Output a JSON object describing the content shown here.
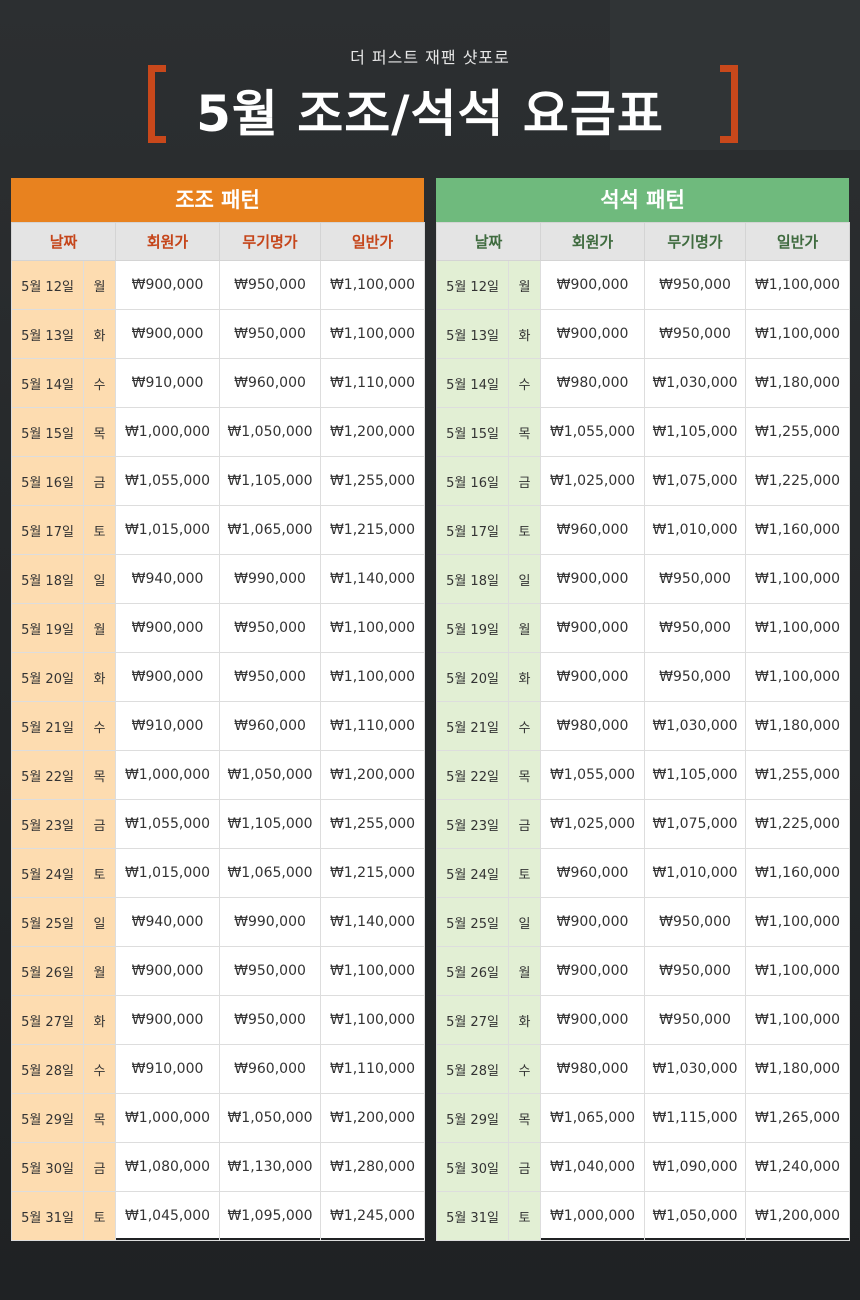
{
  "header": {
    "subtitle": "더 퍼스트 재팬 샷포로",
    "title": "5월 조조/석석 요금표"
  },
  "columns": {
    "date": "날짜",
    "member": "회원가",
    "sky": "무기명가",
    "general": "일반가"
  },
  "morning": {
    "title": "조조 패턴",
    "rows": [
      {
        "date": "5월 12일",
        "day": "월",
        "member": "₩900,000",
        "sky": "₩950,000",
        "general": "₩1,100,000"
      },
      {
        "date": "5월 13일",
        "day": "화",
        "member": "₩900,000",
        "sky": "₩950,000",
        "general": "₩1,100,000"
      },
      {
        "date": "5월 14일",
        "day": "수",
        "member": "₩910,000",
        "sky": "₩960,000",
        "general": "₩1,110,000"
      },
      {
        "date": "5월 15일",
        "day": "목",
        "member": "₩1,000,000",
        "sky": "₩1,050,000",
        "general": "₩1,200,000"
      },
      {
        "date": "5월 16일",
        "day": "금",
        "member": "₩1,055,000",
        "sky": "₩1,105,000",
        "general": "₩1,255,000"
      },
      {
        "date": "5월 17일",
        "day": "토",
        "member": "₩1,015,000",
        "sky": "₩1,065,000",
        "general": "₩1,215,000"
      },
      {
        "date": "5월 18일",
        "day": "일",
        "member": "₩940,000",
        "sky": "₩990,000",
        "general": "₩1,140,000"
      },
      {
        "date": "5월 19일",
        "day": "월",
        "member": "₩900,000",
        "sky": "₩950,000",
        "general": "₩1,100,000"
      },
      {
        "date": "5월 20일",
        "day": "화",
        "member": "₩900,000",
        "sky": "₩950,000",
        "general": "₩1,100,000"
      },
      {
        "date": "5월 21일",
        "day": "수",
        "member": "₩910,000",
        "sky": "₩960,000",
        "general": "₩1,110,000"
      },
      {
        "date": "5월 22일",
        "day": "목",
        "member": "₩1,000,000",
        "sky": "₩1,050,000",
        "general": "₩1,200,000"
      },
      {
        "date": "5월 23일",
        "day": "금",
        "member": "₩1,055,000",
        "sky": "₩1,105,000",
        "general": "₩1,255,000"
      },
      {
        "date": "5월 24일",
        "day": "토",
        "member": "₩1,015,000",
        "sky": "₩1,065,000",
        "general": "₩1,215,000"
      },
      {
        "date": "5월 25일",
        "day": "일",
        "member": "₩940,000",
        "sky": "₩990,000",
        "general": "₩1,140,000"
      },
      {
        "date": "5월 26일",
        "day": "월",
        "member": "₩900,000",
        "sky": "₩950,000",
        "general": "₩1,100,000"
      },
      {
        "date": "5월 27일",
        "day": "화",
        "member": "₩900,000",
        "sky": "₩950,000",
        "general": "₩1,100,000"
      },
      {
        "date": "5월 28일",
        "day": "수",
        "member": "₩910,000",
        "sky": "₩960,000",
        "general": "₩1,110,000"
      },
      {
        "date": "5월 29일",
        "day": "목",
        "member": "₩1,000,000",
        "sky": "₩1,050,000",
        "general": "₩1,200,000"
      },
      {
        "date": "5월 30일",
        "day": "금",
        "member": "₩1,080,000",
        "sky": "₩1,130,000",
        "general": "₩1,280,000"
      },
      {
        "date": "5월 31일",
        "day": "토",
        "member": "₩1,045,000",
        "sky": "₩1,095,000",
        "general": "₩1,245,000"
      }
    ]
  },
  "evening": {
    "title": "석석 패턴",
    "rows": [
      {
        "date": "5월 12일",
        "day": "월",
        "member": "₩900,000",
        "sky": "₩950,000",
        "general": "₩1,100,000"
      },
      {
        "date": "5월 13일",
        "day": "화",
        "member": "₩900,000",
        "sky": "₩950,000",
        "general": "₩1,100,000"
      },
      {
        "date": "5월 14일",
        "day": "수",
        "member": "₩980,000",
        "sky": "₩1,030,000",
        "general": "₩1,180,000"
      },
      {
        "date": "5월 15일",
        "day": "목",
        "member": "₩1,055,000",
        "sky": "₩1,105,000",
        "general": "₩1,255,000"
      },
      {
        "date": "5월 16일",
        "day": "금",
        "member": "₩1,025,000",
        "sky": "₩1,075,000",
        "general": "₩1,225,000"
      },
      {
        "date": "5월 17일",
        "day": "토",
        "member": "₩960,000",
        "sky": "₩1,010,000",
        "general": "₩1,160,000"
      },
      {
        "date": "5월 18일",
        "day": "일",
        "member": "₩900,000",
        "sky": "₩950,000",
        "general": "₩1,100,000"
      },
      {
        "date": "5월 19일",
        "day": "월",
        "member": "₩900,000",
        "sky": "₩950,000",
        "general": "₩1,100,000"
      },
      {
        "date": "5월 20일",
        "day": "화",
        "member": "₩900,000",
        "sky": "₩950,000",
        "general": "₩1,100,000"
      },
      {
        "date": "5월 21일",
        "day": "수",
        "member": "₩980,000",
        "sky": "₩1,030,000",
        "general": "₩1,180,000"
      },
      {
        "date": "5월 22일",
        "day": "목",
        "member": "₩1,055,000",
        "sky": "₩1,105,000",
        "general": "₩1,255,000"
      },
      {
        "date": "5월 23일",
        "day": "금",
        "member": "₩1,025,000",
        "sky": "₩1,075,000",
        "general": "₩1,225,000"
      },
      {
        "date": "5월 24일",
        "day": "토",
        "member": "₩960,000",
        "sky": "₩1,010,000",
        "general": "₩1,160,000"
      },
      {
        "date": "5월 25일",
        "day": "일",
        "member": "₩900,000",
        "sky": "₩950,000",
        "general": "₩1,100,000"
      },
      {
        "date": "5월 26일",
        "day": "월",
        "member": "₩900,000",
        "sky": "₩950,000",
        "general": "₩1,100,000"
      },
      {
        "date": "5월 27일",
        "day": "화",
        "member": "₩900,000",
        "sky": "₩950,000",
        "general": "₩1,100,000"
      },
      {
        "date": "5월 28일",
        "day": "수",
        "member": "₩980,000",
        "sky": "₩1,030,000",
        "general": "₩1,180,000"
      },
      {
        "date": "5월 29일",
        "day": "목",
        "member": "₩1,065,000",
        "sky": "₩1,115,000",
        "general": "₩1,265,000"
      },
      {
        "date": "5월 30일",
        "day": "금",
        "member": "₩1,040,000",
        "sky": "₩1,090,000",
        "general": "₩1,240,000"
      },
      {
        "date": "5월 31일",
        "day": "토",
        "member": "₩1,000,000",
        "sky": "₩1,050,000",
        "general": "₩1,200,000"
      }
    ]
  }
}
